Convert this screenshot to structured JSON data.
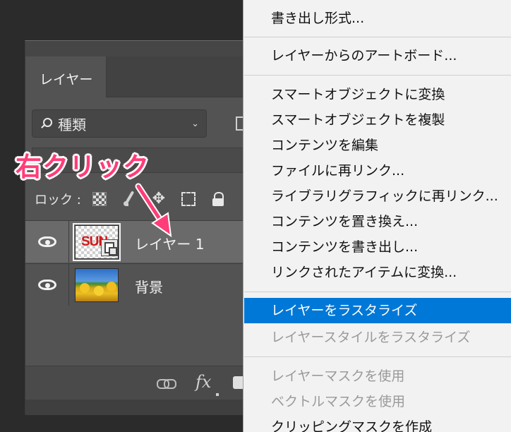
{
  "layers_panel": {
    "tab_label": "レイヤー",
    "filter": {
      "label": "種類",
      "icon": "search-icon",
      "dropdown_icon": "chevron-down-icon"
    },
    "lock_label": "ロック :",
    "layers": [
      {
        "name": "レイヤー 1",
        "thumbnail_text": "SUN",
        "type": "smart-object",
        "selected": true,
        "visible": true
      },
      {
        "name": "背景",
        "type": "image",
        "selected": false,
        "visible": true
      }
    ],
    "footer": {
      "fx_label": "fx"
    }
  },
  "annotation": {
    "text": "右クリック",
    "color": "#ff3d78"
  },
  "context_menu": {
    "highlight_color": "#0078d7",
    "groups": [
      [
        {
          "label": "書き出し形式...",
          "enabled": true
        }
      ],
      [
        {
          "label": "レイヤーからのアートボード...",
          "enabled": true
        }
      ],
      [
        {
          "label": "スマートオブジェクトに変換",
          "enabled": true
        },
        {
          "label": "スマートオブジェクトを複製",
          "enabled": true
        },
        {
          "label": "コンテンツを編集",
          "enabled": true
        },
        {
          "label": "ファイルに再リンク...",
          "enabled": true
        },
        {
          "label": "ライブラリグラフィックに再リンク...",
          "enabled": true
        },
        {
          "label": "コンテンツを置き換え...",
          "enabled": true
        },
        {
          "label": "コンテンツを書き出し...",
          "enabled": true
        },
        {
          "label": "リンクされたアイテムに変換...",
          "enabled": true
        }
      ],
      [
        {
          "label": "レイヤーをラスタライズ",
          "enabled": true,
          "highlighted": true
        },
        {
          "label": "レイヤースタイルをラスタライズ",
          "enabled": false
        }
      ],
      [
        {
          "label": "レイヤーマスクを使用",
          "enabled": false
        },
        {
          "label": "ベクトルマスクを使用",
          "enabled": false
        },
        {
          "label": "クリッピングマスクを作成",
          "enabled": true
        }
      ]
    ]
  }
}
